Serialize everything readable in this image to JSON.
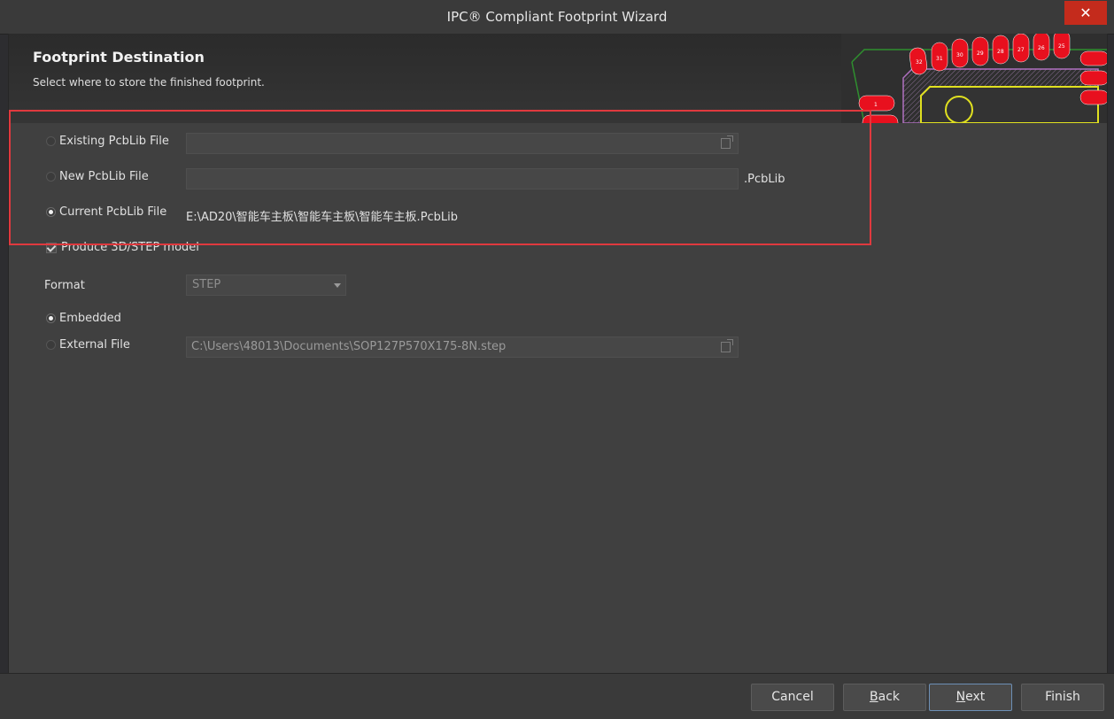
{
  "window": {
    "title": "IPC® Compliant Footprint Wizard",
    "close_glyph": "✕"
  },
  "header": {
    "title": "Footprint Destination",
    "subtitle": "Select where to store the finished footprint."
  },
  "banner_pad_numbers": [
    "32",
    "31",
    "30",
    "29",
    "28",
    "27",
    "26",
    "25",
    "1"
  ],
  "destination": {
    "existing": {
      "label": "Existing PcbLib File",
      "value": "",
      "selected": false
    },
    "new": {
      "label": "New PcbLib File",
      "value": "",
      "suffix": ".PcbLib",
      "selected": false
    },
    "current": {
      "label": "Current PcbLib File",
      "path": "E:\\AD20\\智能车主板\\智能车主板\\智能车主板.PcbLib",
      "selected": true
    }
  },
  "step_model": {
    "checkbox_label": "Produce 3D/STEP model",
    "checked": true,
    "format_label": "Format",
    "format_value": "STEP",
    "embedded_label": "Embedded",
    "external_label": "External File",
    "external_path": "C:\\Users\\48013\\Documents\\SOP127P570X175-8N.step"
  },
  "buttons": {
    "cancel": "Cancel",
    "back_first": "B",
    "back_rest": "ack",
    "next_first": "N",
    "next_rest": "ext",
    "finish": "Finish"
  },
  "colors": {
    "highlight": "#e0393e",
    "close": "#c42b1c",
    "pad": "#e8101e"
  }
}
